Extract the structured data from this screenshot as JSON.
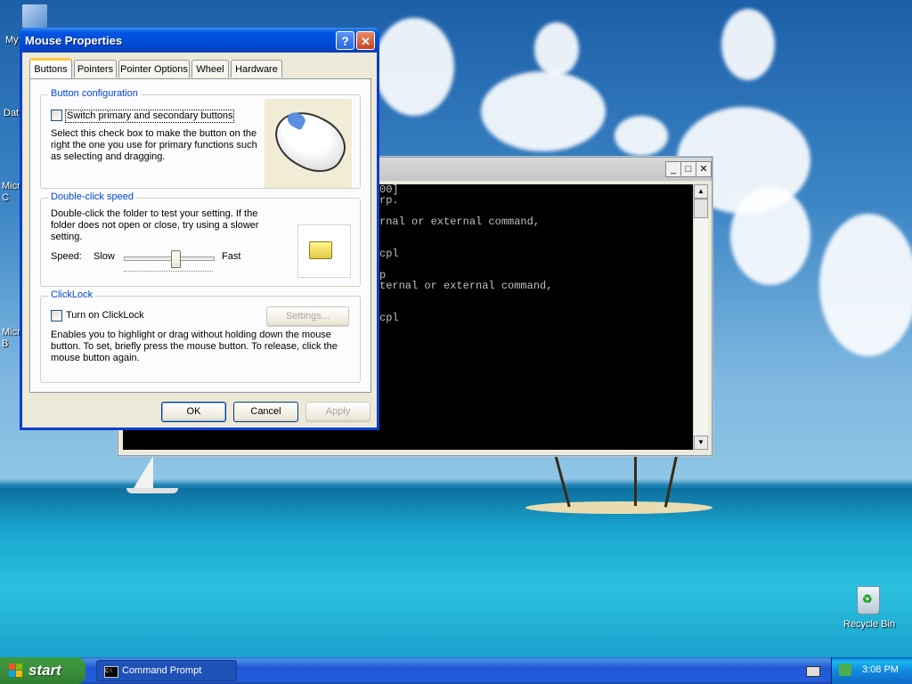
{
  "desktop": {
    "icons": [
      {
        "label": "My",
        "icon": "my-computer-icon"
      },
      {
        "label": "Dat",
        "icon": "folder-icon"
      },
      {
        "label": "Micro C",
        "icon": "app-icon"
      },
      {
        "label": "Micro B",
        "icon": "app-icon"
      },
      {
        "label": "Recycle Bin",
        "icon": "recycle-bin-icon"
      }
    ]
  },
  "cmd_window": {
    "buttons": {
      "minimize": "_",
      "maximize": "□",
      "close": "✕"
    },
    "lines": [
      "00]",
      "rp.",
      "",
      "rnal or external command,",
      "",
      "",
      "cpl",
      "",
      "p",
      "ternal or external command,",
      "",
      "",
      "cpl"
    ]
  },
  "dialog": {
    "title": "Mouse Properties",
    "help_btn": "?",
    "close_btn": "✕",
    "tabs": [
      "Buttons",
      "Pointers",
      "Pointer Options",
      "Wheel",
      "Hardware"
    ],
    "active_tab": "Buttons",
    "button_config": {
      "label": "Button configuration",
      "checkbox_label": "Switch primary and secondary buttons",
      "checked": false,
      "description": "Select this check box to make the button on the right the one you use for primary functions such as selecting and dragging."
    },
    "double_click": {
      "label": "Double-click speed",
      "description": "Double-click the folder to test your setting. If the folder does not open or close, try using a slower setting.",
      "speed_label": "Speed:",
      "slow_label": "Slow",
      "fast_label": "Fast",
      "slider_value": 0.6
    },
    "clicklock": {
      "label": "ClickLock",
      "checkbox_label": "Turn on ClickLock",
      "checked": false,
      "settings_button": "Settings...",
      "description": "Enables you to highlight or drag without holding down the mouse button. To set, briefly press the mouse button. To release, click the mouse button again."
    },
    "buttons": {
      "ok": "OK",
      "cancel": "Cancel",
      "apply": "Apply"
    }
  },
  "taskbar": {
    "start_label": "start",
    "tasks": [
      {
        "label": "Command Prompt",
        "icon": "cmd-icon"
      }
    ],
    "clock": "3:08 PM"
  }
}
